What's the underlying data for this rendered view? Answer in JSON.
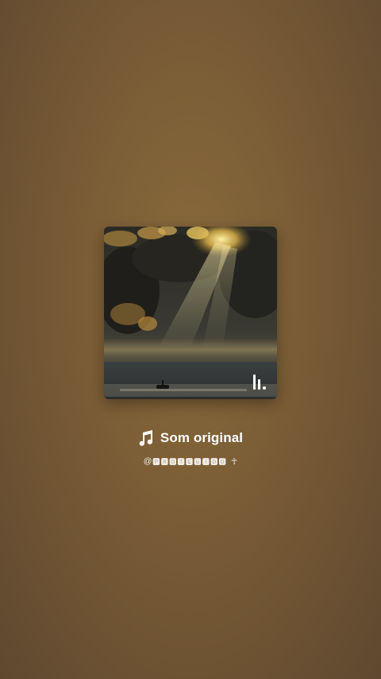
{
  "track": {
    "title": "Som original",
    "handle_prefix": "@",
    "handle": "🅿🆁🅾🆃🅴🅶🅸🅳🅾",
    "handle_suffix": "☥"
  },
  "icons": {
    "music": "music-note-icon",
    "audio_indicator": "audio-bars-icon"
  },
  "colors": {
    "background": "#7d5f37",
    "text": "#ffffff"
  }
}
